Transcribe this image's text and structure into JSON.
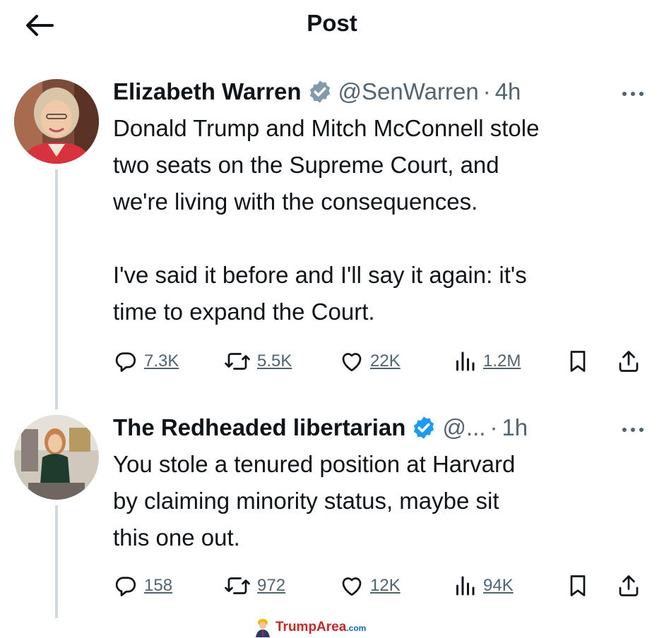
{
  "header": {
    "title": "Post"
  },
  "tweets": [
    {
      "name": "Elizabeth Warren",
      "handle": "@SenWarren",
      "dot": "·",
      "time": "4h",
      "text": "Donald Trump and Mitch McConnell stole\ntwo seats on the Supreme Court, and\nwe're living with the consequences.\n\nI've said it before and I'll say it again: it's\ntime to expand the Court.",
      "stats": {
        "replies": "7.3K",
        "reposts": "5.5K",
        "likes": "22K",
        "views": "1.2M"
      },
      "verified_color": "#829aab"
    },
    {
      "name": "The Redheaded libertarian",
      "handle": "@...",
      "dot": "·",
      "time": "1h",
      "text": "You stole a tenured position at Harvard\nby claiming minority status, maybe sit\nthis one out.",
      "stats": {
        "replies": "158",
        "reposts": "972",
        "likes": "12K",
        "views": "94K"
      },
      "verified_color": "#1d9bf0"
    }
  ],
  "watermark": {
    "brand": "TrumpArea",
    "tld": ".com"
  },
  "colors": {
    "text": "#0f1419",
    "secondary": "#536471",
    "thread": "#cfd9de"
  },
  "icons": [
    "back-arrow-icon",
    "verified-badge-icon",
    "more-icon",
    "reply-icon",
    "repost-icon",
    "like-icon",
    "views-icon",
    "bookmark-icon",
    "share-icon"
  ]
}
